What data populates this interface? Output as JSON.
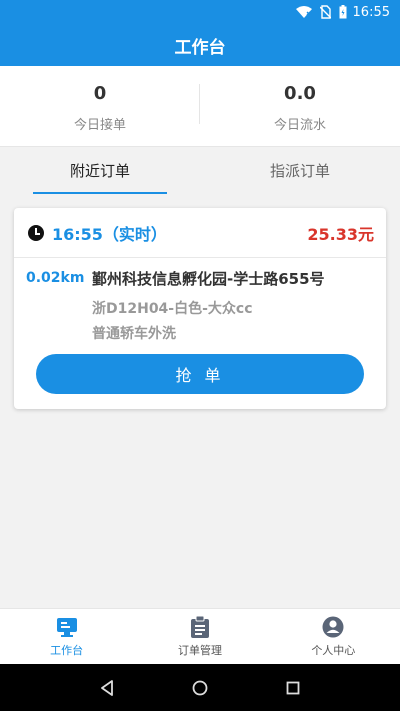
{
  "status_bar": {
    "time": "16:55",
    "icons": [
      "wifi-icon",
      "no-sim-icon",
      "battery-icon"
    ]
  },
  "header": {
    "title": "工作台"
  },
  "stats": [
    {
      "value": "0",
      "label": "今日接单"
    },
    {
      "value": "0.0",
      "label": "今日流水"
    }
  ],
  "tabs": [
    {
      "label": "附近订单",
      "active": true
    },
    {
      "label": "指派订单",
      "active": false
    }
  ],
  "order": {
    "time": "16:55（实时）",
    "price": "25.33元",
    "distance": "0.02km",
    "address": "鄞州科技信息孵化园-学士路655号",
    "vehicle": "浙D12H04-白色-大众cc",
    "service": "普通轿车外洗",
    "grab_label": "抢 单"
  },
  "bottom_nav": [
    {
      "label": "工作台",
      "icon": "monitor-icon",
      "active": true
    },
    {
      "label": "订单管理",
      "icon": "clipboard-icon",
      "active": false
    },
    {
      "label": "个人中心",
      "icon": "user-icon",
      "active": false
    }
  ],
  "colors": {
    "primary": "#1a8fe3",
    "price": "#d9352b"
  }
}
